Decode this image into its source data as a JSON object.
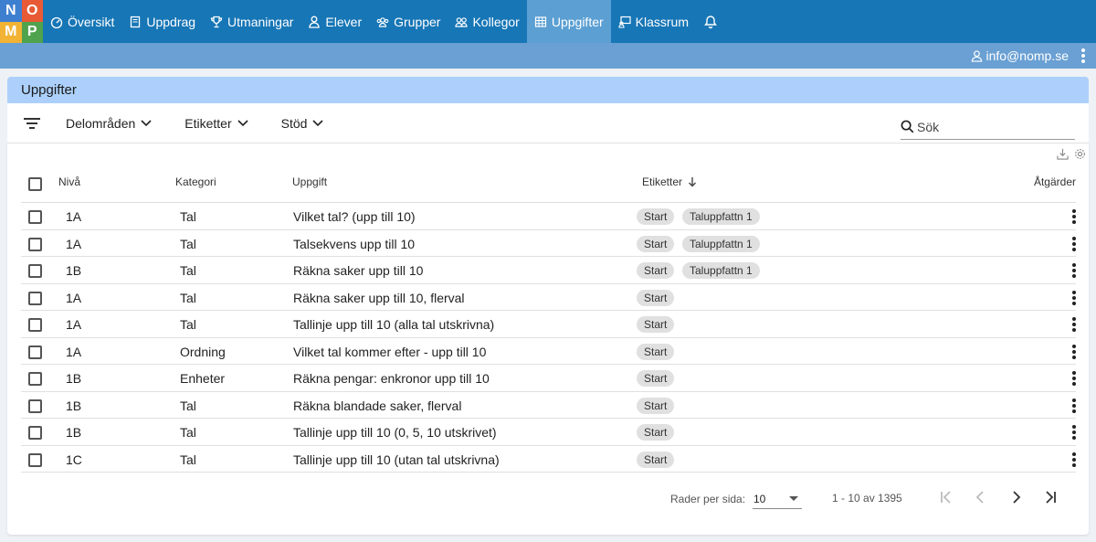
{
  "logo": {
    "letters": [
      "N",
      "O",
      "M",
      "P"
    ]
  },
  "nav": [
    {
      "label": "Översikt",
      "icon": "gauge-icon"
    },
    {
      "label": "Uppdrag",
      "icon": "book-icon"
    },
    {
      "label": "Utmaningar",
      "icon": "trophy-icon"
    },
    {
      "label": "Elever",
      "icon": "person-icon"
    },
    {
      "label": "Grupper",
      "icon": "group-icon"
    },
    {
      "label": "Kollegor",
      "icon": "colleagues-icon"
    },
    {
      "label": "Uppgifter",
      "icon": "table-icon",
      "active": true
    },
    {
      "label": "Klassrum",
      "icon": "classroom-icon"
    }
  ],
  "user": {
    "email": "info@nomp.se"
  },
  "page": {
    "title": "Uppgifter"
  },
  "filters": {
    "dropdowns": [
      "Delområden",
      "Etiketter",
      "Stöd"
    ],
    "search_placeholder": "Sök"
  },
  "table": {
    "headers": {
      "level": "Nivå",
      "category": "Kategori",
      "task": "Uppgift",
      "tags": "Etiketter",
      "actions": "Åtgärder"
    },
    "rows": [
      {
        "level": "1A",
        "category": "Tal",
        "task": "Vilket tal? (upp till 10)",
        "tags": [
          "Start",
          "Taluppfattn 1"
        ]
      },
      {
        "level": "1A",
        "category": "Tal",
        "task": "Talsekvens upp till 10",
        "tags": [
          "Start",
          "Taluppfattn 1"
        ]
      },
      {
        "level": "1B",
        "category": "Tal",
        "task": "Räkna saker upp till 10",
        "tags": [
          "Start",
          "Taluppfattn 1"
        ]
      },
      {
        "level": "1A",
        "category": "Tal",
        "task": "Räkna saker upp till 10, flerval",
        "tags": [
          "Start"
        ]
      },
      {
        "level": "1A",
        "category": "Tal",
        "task": "Tallinje upp till 10 (alla tal utskrivna)",
        "tags": [
          "Start"
        ]
      },
      {
        "level": "1A",
        "category": "Ordning",
        "task": "Vilket tal kommer efter - upp till 10",
        "tags": [
          "Start"
        ]
      },
      {
        "level": "1B",
        "category": "Enheter",
        "task": "Räkna pengar: enkronor upp till 10",
        "tags": [
          "Start"
        ]
      },
      {
        "level": "1B",
        "category": "Tal",
        "task": "Räkna blandade saker, flerval",
        "tags": [
          "Start"
        ]
      },
      {
        "level": "1B",
        "category": "Tal",
        "task": "Tallinje upp till 10 (0, 5, 10 utskrivet)",
        "tags": [
          "Start"
        ]
      },
      {
        "level": "1C",
        "category": "Tal",
        "task": "Tallinje upp till 10 (utan tal utskrivna)",
        "tags": [
          "Start"
        ]
      }
    ]
  },
  "pagination": {
    "rows_label": "Rader per sida:",
    "rows_value": "10",
    "range": "1 - 10 av 1395"
  },
  "colors": {
    "nav_bg": "#1776b6",
    "nav_active": "#5b9fd3",
    "subbar": "#6aa0d3",
    "page_head": "#acd0fb"
  }
}
